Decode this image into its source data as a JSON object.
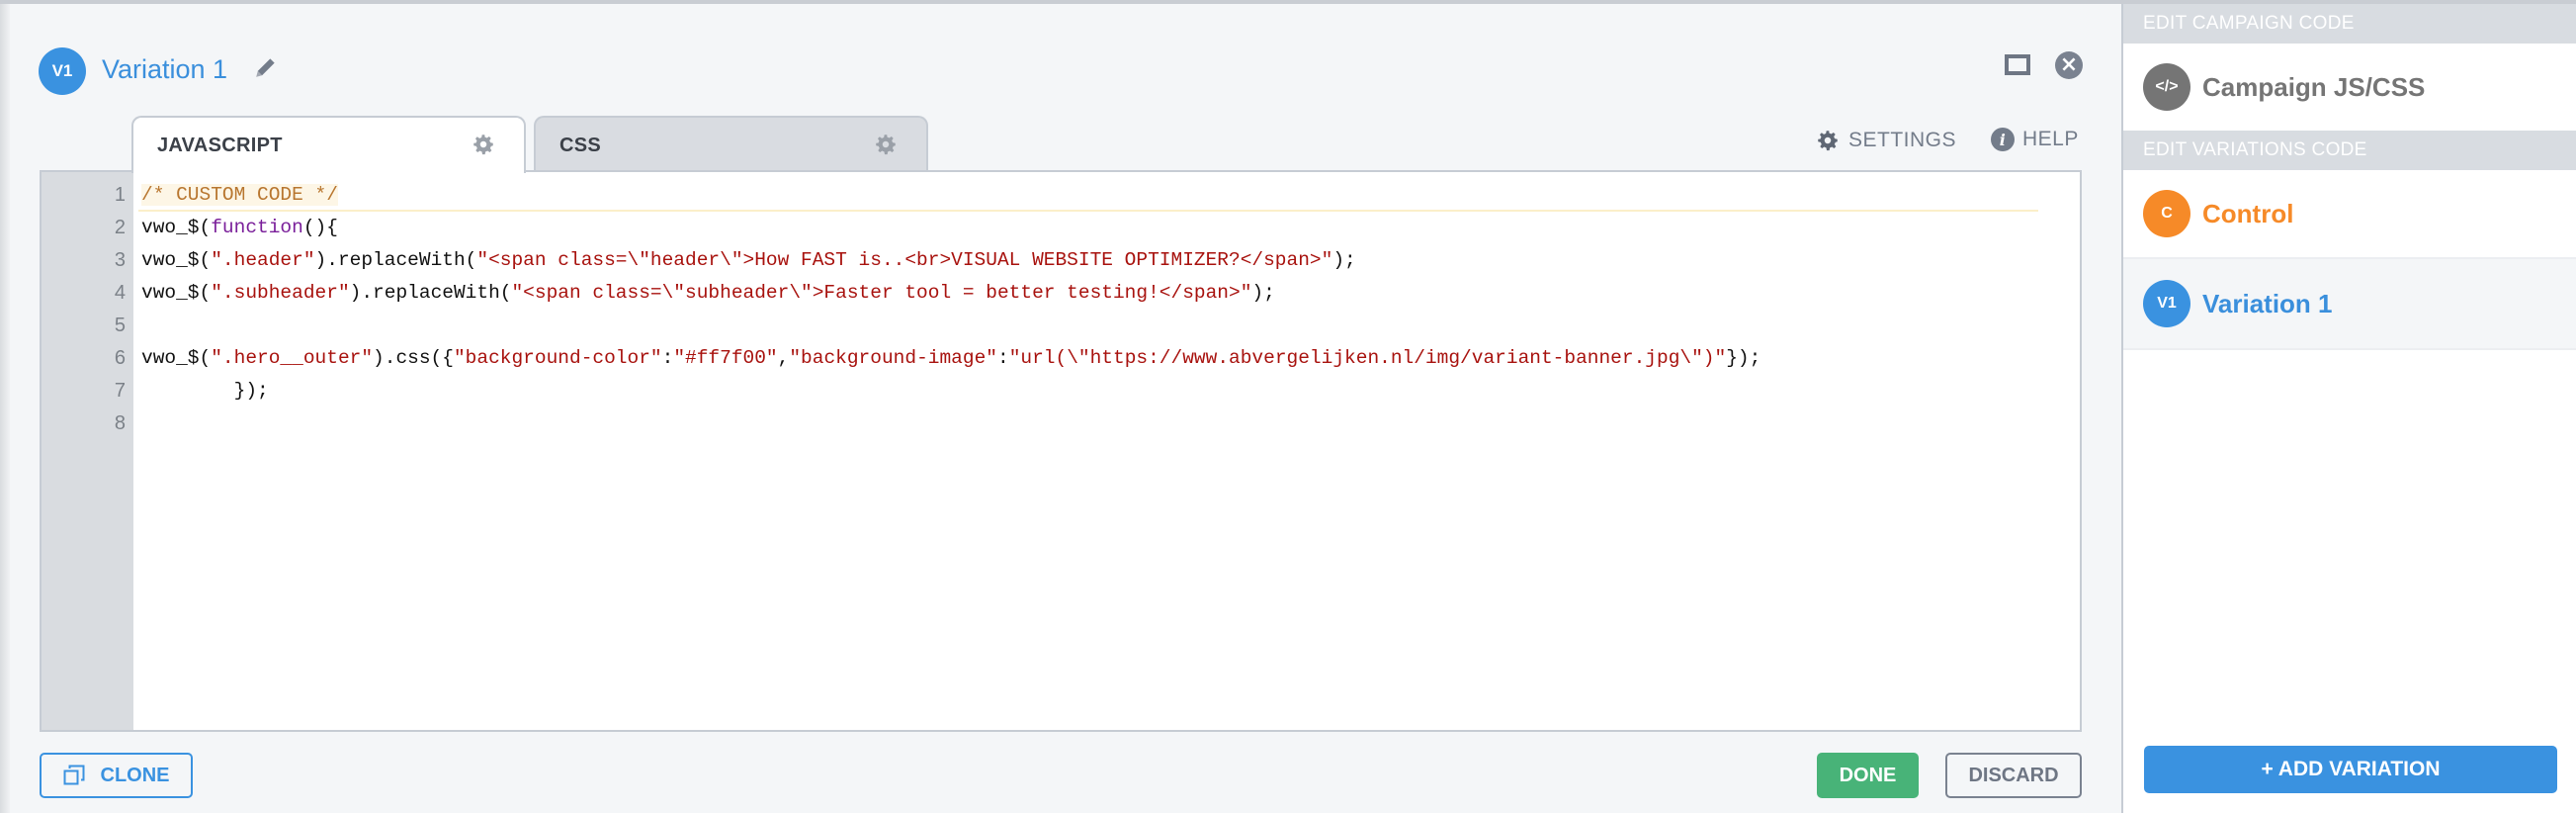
{
  "header": {
    "avatar": "V1",
    "title": "Variation 1",
    "edit_icon": "pencil-icon",
    "maximize_icon": "square-icon",
    "close_icon": "close-circle-icon",
    "accent_color": "#3a92e0"
  },
  "tabs": [
    {
      "label": "JAVASCRIPT",
      "icon": "gear-icon",
      "active": true
    },
    {
      "label": "CSS",
      "icon": "gear-icon",
      "active": false
    }
  ],
  "toolbar": {
    "settings_label": "SETTINGS",
    "settings_icon": "gear-icon",
    "help_label": "HELP",
    "help_icon": "info-icon",
    "help_glyph": "i"
  },
  "editor": {
    "line_numbers": [
      "1",
      "2",
      "3",
      "4",
      "5",
      "6",
      "7",
      "8"
    ],
    "lines": [
      [
        {
          "t": "comment",
          "s": "/* CUSTOM CODE */"
        }
      ],
      [
        {
          "t": "plain",
          "s": "vwo_$("
        },
        {
          "t": "kw",
          "s": "function"
        },
        {
          "t": "plain",
          "s": "(){"
        }
      ],
      [
        {
          "t": "plain",
          "s": "vwo_$("
        },
        {
          "t": "str",
          "s": "\".header\""
        },
        {
          "t": "plain",
          "s": ").replaceWith("
        },
        {
          "t": "str",
          "s": "\"<span class=\\\"header\\\">How FAST is..<br>VISUAL WEBSITE OPTIMIZER?</span>\""
        },
        {
          "t": "plain",
          "s": ");"
        }
      ],
      [
        {
          "t": "plain",
          "s": "vwo_$("
        },
        {
          "t": "str",
          "s": "\".subheader\""
        },
        {
          "t": "plain",
          "s": ").replaceWith("
        },
        {
          "t": "str",
          "s": "\"<span class=\\\"subheader\\\">Faster tool = better testing!</span>\""
        },
        {
          "t": "plain",
          "s": ");"
        }
      ],
      [],
      [
        {
          "t": "plain",
          "s": "vwo_$("
        },
        {
          "t": "str",
          "s": "\".hero__outer\""
        },
        {
          "t": "plain",
          "s": ").css({"
        },
        {
          "t": "str",
          "s": "\"background-color\""
        },
        {
          "t": "plain",
          "s": ":"
        },
        {
          "t": "str",
          "s": "\"#ff7f00\""
        },
        {
          "t": "plain",
          "s": ","
        },
        {
          "t": "str",
          "s": "\"background-image\""
        },
        {
          "t": "plain",
          "s": ":"
        },
        {
          "t": "str",
          "s": "\"url(\\\"https://www.abvergelijken.nl/img/variant-banner.jpg\\\")\""
        },
        {
          "t": "plain",
          "s": "});"
        }
      ],
      [
        {
          "t": "plain",
          "s": "        });"
        }
      ],
      []
    ]
  },
  "footer": {
    "clone_label": "CLONE",
    "clone_icon": "copy-icon",
    "done_label": "DONE",
    "discard_label": "DISCARD",
    "done_color": "#48b378"
  },
  "sidebar": {
    "campaign_header": "EDIT CAMPAIGN CODE",
    "campaign_item": {
      "avatar": "</>",
      "label": "Campaign JS/CSS",
      "color": "#757575"
    },
    "variations_header": "EDIT VARIATIONS CODE",
    "variations": [
      {
        "avatar": "C",
        "label": "Control",
        "color": "#f68a28",
        "selected": false
      },
      {
        "avatar": "V1",
        "label": "Variation 1",
        "color": "#3a92e0",
        "selected": true
      }
    ],
    "add_label": "+ ADD VARIATION"
  }
}
